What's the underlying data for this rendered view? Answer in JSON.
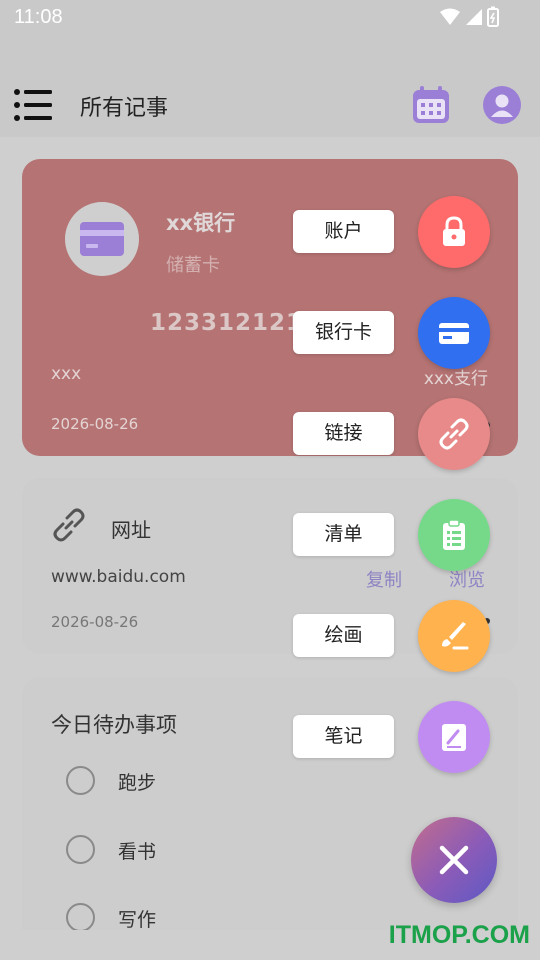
{
  "status_bar": {
    "time": "11:08",
    "icons": [
      "wifi-icon",
      "signal-icon",
      "battery-icon"
    ]
  },
  "app_bar": {
    "title": "所有记事",
    "icons": [
      "menu-icon",
      "calendar-icon",
      "avatar-icon"
    ],
    "accent": "#9b7fd6"
  },
  "bank_card": {
    "name": "xx银行",
    "type": "储蓄卡",
    "number": "1233121213",
    "holder": "xxx",
    "branch": "xxx支行",
    "date": "2026-08-26",
    "background": "#b57373"
  },
  "link_card": {
    "title": "网址",
    "url": "www.baidu.com",
    "copy_label": "复制",
    "browse_label": "浏览",
    "date": "2026-08-26"
  },
  "todo_card": {
    "title": "今日待办事项",
    "items": [
      {
        "label": "跑步"
      },
      {
        "label": "看书"
      },
      {
        "label": "写作"
      }
    ]
  },
  "fab_menu": {
    "items": [
      {
        "label": "账户",
        "icon": "lock-icon",
        "color": "#ff6b6b"
      },
      {
        "label": "银行卡",
        "icon": "card-icon",
        "color": "#2f6ff0"
      },
      {
        "label": "链接",
        "icon": "link-icon",
        "color": "#e88a8a"
      },
      {
        "label": "清单",
        "icon": "clipboard-icon",
        "color": "#76d98a"
      },
      {
        "label": "绘画",
        "icon": "brush-icon",
        "color": "#ffb24d"
      },
      {
        "label": "笔记",
        "icon": "note-icon",
        "color": "#c08cf2"
      }
    ],
    "close_icon": "close-icon"
  },
  "watermark": "ITMOP.COM"
}
